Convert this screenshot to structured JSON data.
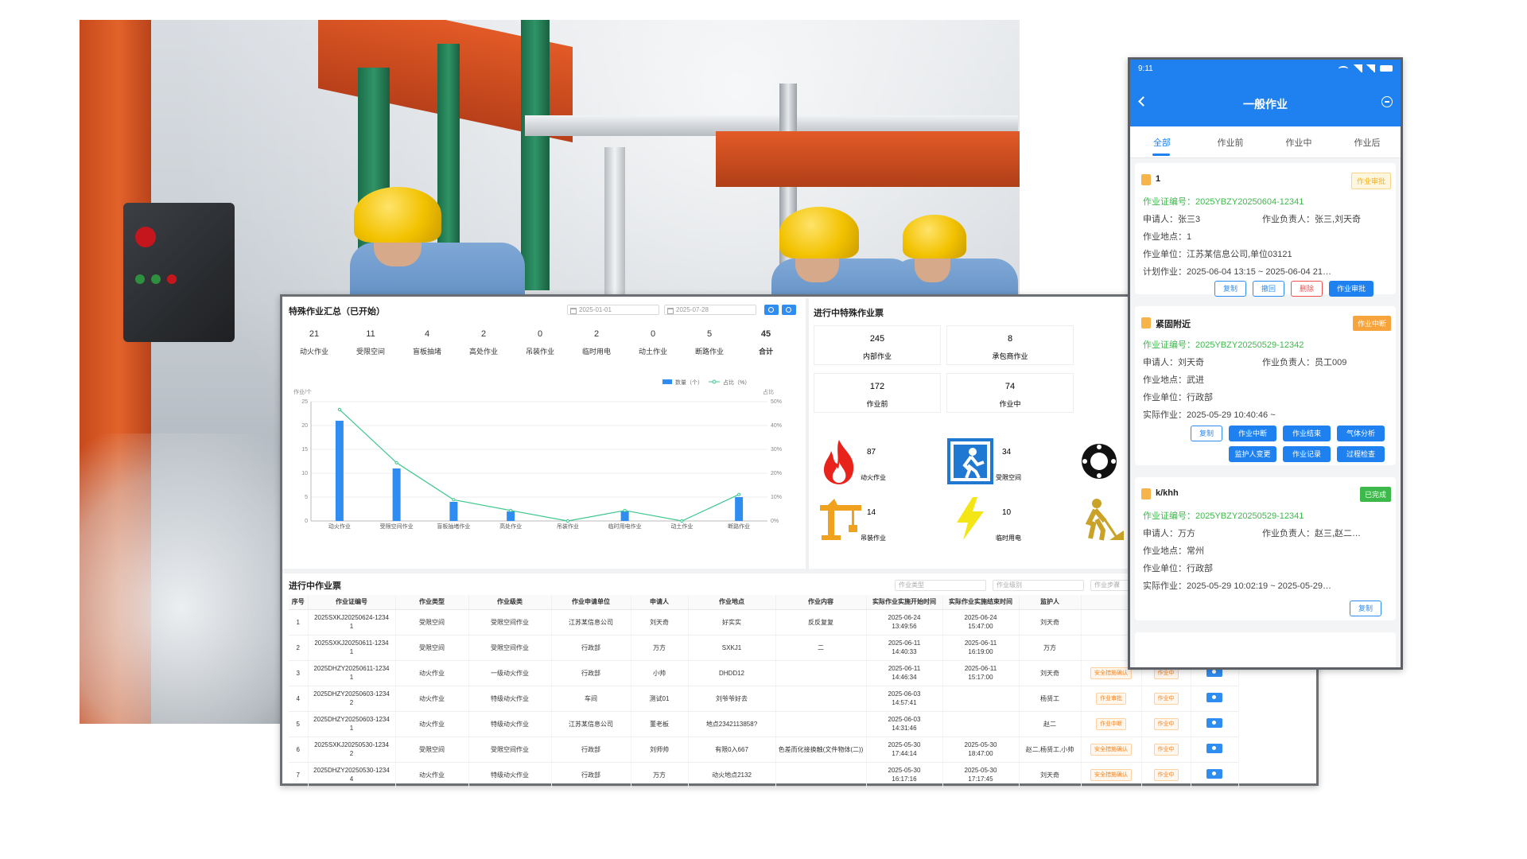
{
  "dashboard": {
    "summary": {
      "title": "特殊作业汇总（已开始）",
      "date_start": "2025-01-01",
      "date_end": "2025-07-28",
      "stats": [
        {
          "value": "21",
          "label": "动火作业"
        },
        {
          "value": "11",
          "label": "受限空间"
        },
        {
          "value": "4",
          "label": "盲板抽堵"
        },
        {
          "value": "2",
          "label": "高处作业"
        },
        {
          "value": "0",
          "label": "吊装作业"
        },
        {
          "value": "2",
          "label": "临时用电"
        },
        {
          "value": "0",
          "label": "动土作业"
        },
        {
          "value": "5",
          "label": "断路作业"
        },
        {
          "value": "45",
          "label": "合计"
        }
      ]
    },
    "chart_data": {
      "type": "bar",
      "categories": [
        "动火作业",
        "受限空间作业",
        "盲板抽堵作业",
        "高处作业",
        "吊装作业",
        "临时用电作业",
        "动土作业",
        "断路作业"
      ],
      "series": [
        {
          "name": "数量（个）",
          "type": "bar",
          "values": [
            21,
            11,
            4,
            2,
            0,
            2,
            0,
            5
          ],
          "color": "#2f8cf0"
        },
        {
          "name": "占比（%）",
          "type": "line",
          "values": [
            46.7,
            24.4,
            8.9,
            4.4,
            0,
            4.4,
            0,
            11.1
          ],
          "color": "#3cc88c"
        }
      ],
      "ylabel": "作业/个",
      "y2label": "占比",
      "ylim": [
        0,
        25
      ],
      "y2lim": [
        0,
        50
      ],
      "yticks": [
        "0",
        "5",
        "10",
        "15",
        "20",
        "25"
      ],
      "y2ticks": [
        "0%",
        "10%",
        "20%",
        "30%",
        "40%",
        "50%"
      ],
      "legend": "top-right",
      "grid": true
    },
    "in_progress": {
      "title": "进行中特殊作业票",
      "cards": [
        {
          "value": "245",
          "label": "内部作业"
        },
        {
          "value": "8",
          "label": "承包商作业"
        },
        {
          "value": "172",
          "label": "作业前"
        },
        {
          "value": "74",
          "label": "作业中"
        }
      ],
      "types": [
        {
          "value": "87",
          "label": "动火作业",
          "icon": "fire-icon"
        },
        {
          "value": "34",
          "label": "受限空间",
          "icon": "confined-space-icon"
        },
        {
          "value": "14",
          "label": "吊装作业",
          "icon": "crane-icon"
        },
        {
          "value": "10",
          "label": "临时用电",
          "icon": "lightning-icon"
        }
      ]
    },
    "table": {
      "title": "进行中作业票",
      "filters": [
        "作业类型",
        "作业级别",
        "作业步骤"
      ],
      "headers": [
        "序号",
        "作业证编号",
        "作业类型",
        "作业级类",
        "作业申请单位",
        "申请人",
        "作业地点",
        "作业内容",
        "实际作业实施开始时间",
        "实际作业实施结束时间",
        "监护人"
      ],
      "rows": [
        {
          "no": "1",
          "code": "2025SXKJ20250624-1234\n1",
          "type": "受限空间",
          "level": "受限空间作业",
          "unit": "江苏某信息公司",
          "applicant": "刘天奇",
          "place": "好实实",
          "content": "反反复复",
          "start": "2025-06-24\n13:49:56",
          "end": "2025-06-24\n15:47:00",
          "guard": "刘天奇",
          "step": "",
          "state": ""
        },
        {
          "no": "2",
          "code": "2025SXKJ20250611-1234\n1",
          "type": "受限空间",
          "level": "受限空间作业",
          "unit": "行政部",
          "applicant": "万方",
          "place": "SXKJ1",
          "content": "二",
          "start": "2025-06-11\n14:40:33",
          "end": "2025-06-11\n16:19:00",
          "guard": "万方",
          "step": "",
          "state": ""
        },
        {
          "no": "3",
          "code": "2025DHZY20250611-1234\n1",
          "type": "动火作业",
          "level": "一级动火作业",
          "unit": "行政部",
          "applicant": "小帅",
          "place": "DHDD12",
          "content": "",
          "start": "2025-06-11\n14:46:34",
          "end": "2025-06-11\n15:17:00",
          "guard": "刘天奇",
          "step": "安全措施确认",
          "state": "作业中"
        },
        {
          "no": "4",
          "code": "2025DHZY20250603-1234\n2",
          "type": "动火作业",
          "level": "特级动火作业",
          "unit": "车间",
          "applicant": "测试01",
          "place": "刘爷爷好去",
          "content": "",
          "start": "2025-06-03\n14:57:41",
          "end": "",
          "guard": "杨贤工",
          "step": "作业审批",
          "state": "作业中"
        },
        {
          "no": "5",
          "code": "2025DHZY20250603-1234\n1",
          "type": "动火作业",
          "level": "特级动火作业",
          "unit": "江苏某信息公司",
          "applicant": "董老板",
          "place": "地点2342113858?",
          "content": "",
          "start": "2025-06-03\n14:31:46",
          "end": "",
          "guard": "赵二",
          "step": "作业中断",
          "state": "作业中"
        },
        {
          "no": "6",
          "code": "2025SXKJ20250530-1234\n2",
          "type": "受限空间",
          "level": "受限空间作业",
          "unit": "行政部",
          "applicant": "刘师帅",
          "place": "有限0入667",
          "content": "色差而化接换触(文件物体(二))",
          "start": "2025-05-30\n17:44:14",
          "end": "2025-05-30\n18:47:00",
          "guard": "赵二,杨贤工,小帅",
          "step": "安全措施确认",
          "state": "作业中"
        },
        {
          "no": "7",
          "code": "2025DHZY20250530-1234\n4",
          "type": "动火作业",
          "level": "特级动火作业",
          "unit": "行政部",
          "applicant": "万方",
          "place": "动火地点2132",
          "content": "",
          "start": "2025-05-30\n16:17:16",
          "end": "2025-05-30\n17:17:45",
          "guard": "刘天奇",
          "step": "安全措施确认",
          "state": "作业中"
        }
      ]
    }
  },
  "phone": {
    "time": "9:11",
    "title": "一般作业",
    "tabs": [
      "全部",
      "作业前",
      "作业中",
      "作业后"
    ],
    "cards": [
      {
        "title": "1",
        "status": "作业审批",
        "cert": "作业证编号：2025YBZY20250604-12341",
        "applicant": "申请人：张三3",
        "leader": "作业负责人：张三,刘天奇",
        "place": "作业地点：1",
        "unit": "作业单位：江苏某信息公司,单位03121",
        "time": "计划作业：2025-06-04 13:15 ~ 2025-06-04 21…",
        "buttons": [
          "复制",
          "撤回",
          "删除",
          "作业审批"
        ]
      },
      {
        "title": "紧固附近",
        "status": "作业中断",
        "cert": "作业证编号：2025YBZY20250529-12342",
        "applicant": "申请人：刘天奇",
        "leader": "作业负责人：员工009",
        "place": "作业地点：武进",
        "unit": "作业单位：行政部",
        "time": "实际作业：2025-05-29 10:40:46 ~",
        "buttons": [
          "复制",
          "作业中断",
          "作业结束",
          "气体分析",
          "监护人变更",
          "作业记录",
          "过程检查"
        ]
      },
      {
        "title": "k/khh",
        "status": "已完成",
        "cert": "作业证编号：2025YBZY20250529-12341",
        "applicant": "申请人：万方",
        "leader": "作业负责人：赵三,赵二…",
        "place": "作业地点：常州",
        "unit": "作业单位：行政部",
        "time": "实际作业：2025-05-29 10:02:19 ~ 2025-05-29…",
        "buttons": [
          "复制"
        ]
      }
    ]
  }
}
